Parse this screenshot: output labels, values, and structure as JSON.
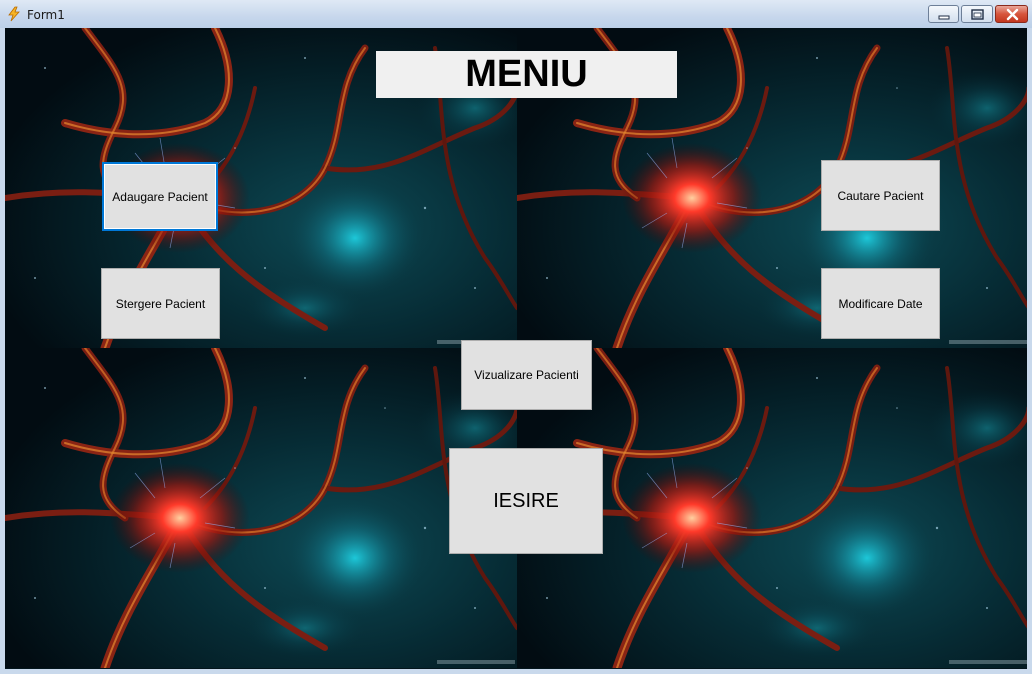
{
  "window": {
    "title": "Form1",
    "icon": "app-lightning-icon",
    "controls": {
      "minimize": "minimize-icon",
      "maximize": "maximize-icon",
      "close": "close-icon"
    }
  },
  "main": {
    "heading": "MENIU",
    "buttons": {
      "add_patient": "Adaugare Pacient",
      "delete_patient": "Stergere Pacient",
      "search_patient": "Cautare Pacient",
      "modify_data": "Modificare Date",
      "view_patients": "Vizualizare Pacienti",
      "exit": "IESIRE"
    },
    "focused_button": "add_patient"
  },
  "colors": {
    "background_base": "#03151c",
    "neuron_glow": "#ff3a2a",
    "nebula_cyan": "#1fd6e8",
    "button_face": "#e1e1e1",
    "focus_border": "#0078d7"
  }
}
